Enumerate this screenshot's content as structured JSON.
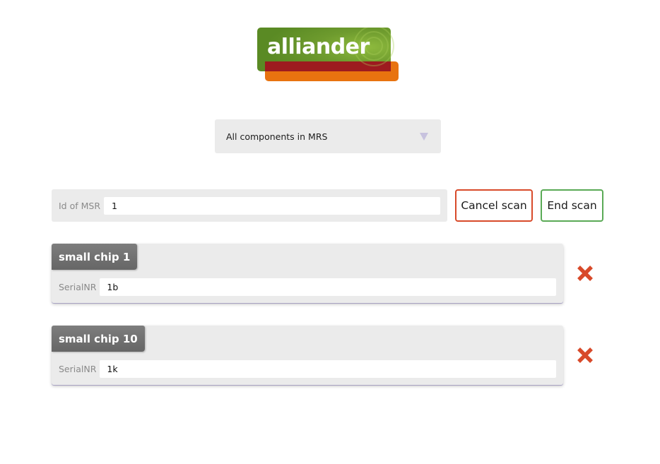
{
  "brand": {
    "logo_text": "alliander",
    "colors": {
      "green": "#6e9b2e",
      "dark_red": "#9d1b1f",
      "orange": "#e8730f"
    }
  },
  "component_select": {
    "selected": "All components in MRS",
    "arrow_color": "#c7c2de"
  },
  "msr": {
    "label": "Id of MSR",
    "value": "1"
  },
  "actions": {
    "cancel_label": "Cancel scan",
    "cancel_color": "#d84a2a",
    "end_label": "End scan",
    "end_color": "#5aaa56"
  },
  "components": [
    {
      "title": "small chip 1",
      "serial_label": "SerialNR",
      "serial_value": "1b",
      "remove_icon": "close-icon"
    },
    {
      "title": "small chip 10",
      "serial_label": "SerialNR",
      "serial_value": "1k",
      "remove_icon": "close-icon"
    }
  ],
  "remove_icon_color": "#d84a2a"
}
